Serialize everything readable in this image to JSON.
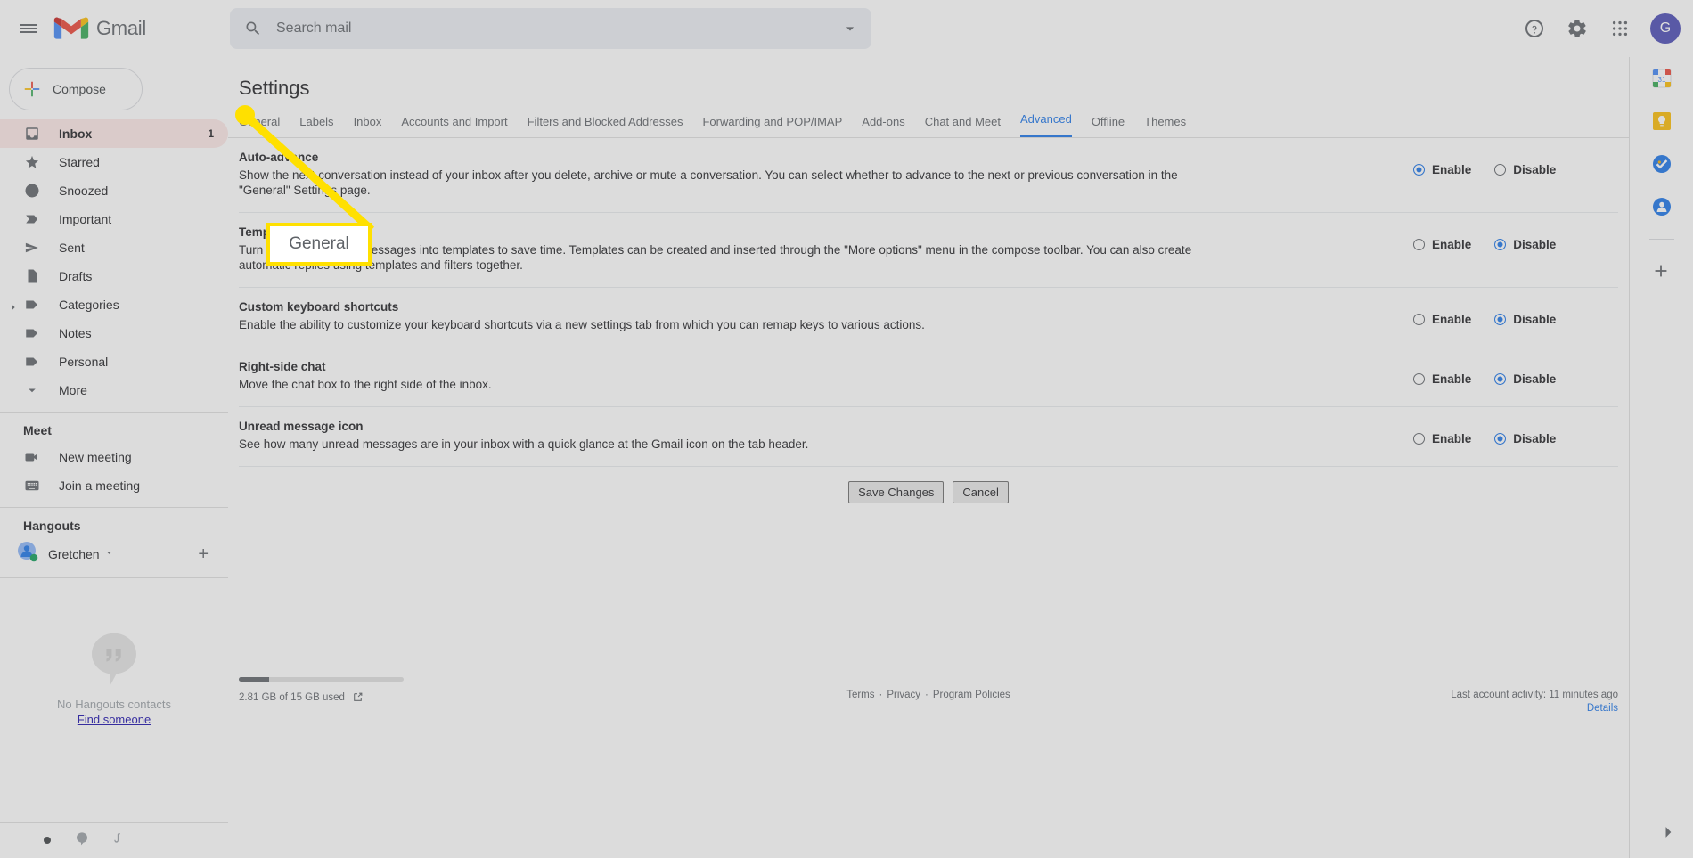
{
  "topbar": {
    "menu_icon": "hamburger-icon",
    "brand": "Gmail",
    "search": {
      "placeholder": "Search mail",
      "value": "",
      "icon": "search-icon",
      "options_icon": "chevron-down-icon"
    },
    "help_icon": "help-circle-icon",
    "settings_icon": "gear-icon",
    "apps_icon": "apps-grid-icon",
    "avatar_letter": "G"
  },
  "sidebar": {
    "compose_label": "Compose",
    "items": [
      {
        "label": "Inbox",
        "icon": "inbox-icon",
        "count": "1",
        "active": true
      },
      {
        "label": "Starred",
        "icon": "star-icon",
        "count": "",
        "active": false
      },
      {
        "label": "Snoozed",
        "icon": "clock-icon",
        "count": "",
        "active": false
      },
      {
        "label": "Important",
        "icon": "important-marker-icon",
        "count": "",
        "active": false
      },
      {
        "label": "Sent",
        "icon": "send-icon",
        "count": "",
        "active": false
      },
      {
        "label": "Drafts",
        "icon": "draft-file-icon",
        "count": "",
        "active": false
      },
      {
        "label": "Categories",
        "icon": "label-tag-icon",
        "count": "",
        "active": false,
        "expandable": true
      },
      {
        "label": "Notes",
        "icon": "label-tag-icon",
        "count": "",
        "active": false
      },
      {
        "label": "Personal",
        "icon": "label-tag-icon",
        "count": "",
        "active": false
      },
      {
        "label": "More",
        "icon": "chevron-down-icon",
        "count": "",
        "active": false
      }
    ],
    "meet": {
      "title": "Meet",
      "items": [
        {
          "label": "New meeting",
          "icon": "video-camera-icon"
        },
        {
          "label": "Join a meeting",
          "icon": "keyboard-icon"
        }
      ]
    },
    "hangouts": {
      "title": "Hangouts",
      "user": "Gretchen",
      "user_caret_icon": "caret-down-icon",
      "add_icon": "plus-icon",
      "empty_text": "No Hangouts contacts",
      "find_link": "Find someone",
      "bubble_icon": "hangouts-quote-icon"
    },
    "bottom_icons": [
      "status-dot-icon",
      "hangouts-icon",
      "phone-icon"
    ]
  },
  "main": {
    "page_title": "Settings",
    "tabs": [
      {
        "label": "General",
        "active": false
      },
      {
        "label": "Labels",
        "active": false
      },
      {
        "label": "Inbox",
        "active": false
      },
      {
        "label": "Accounts and Import",
        "active": false
      },
      {
        "label": "Filters and Blocked Addresses",
        "active": false
      },
      {
        "label": "Forwarding and POP/IMAP",
        "active": false
      },
      {
        "label": "Add-ons",
        "active": false
      },
      {
        "label": "Chat and Meet",
        "active": false
      },
      {
        "label": "Advanced",
        "active": true
      },
      {
        "label": "Offline",
        "active": false
      },
      {
        "label": "Themes",
        "active": false
      }
    ],
    "enable_label": "Enable",
    "disable_label": "Disable",
    "settings": [
      {
        "title": "Auto-advance",
        "description": "Show the next conversation instead of your inbox after you delete, archive or mute a conversation. You can select whether to advance to the next or previous conversation in the \"General\" Settings page.",
        "selected": "enable"
      },
      {
        "title": "Templates",
        "description": "Turn frequently written messages into templates to save time. Templates can be created and inserted through the \"More options\" menu in the compose toolbar. You can also create automatic replies using templates and filters together.",
        "selected": "disable"
      },
      {
        "title": "Custom keyboard shortcuts",
        "description": "Enable the ability to customize your keyboard shortcuts via a new settings tab from which you can remap keys to various actions.",
        "selected": "disable"
      },
      {
        "title": "Right-side chat",
        "description": "Move the chat box to the right side of the inbox.",
        "selected": "disable"
      },
      {
        "title": "Unread message icon",
        "description": "See how many unread messages are in your inbox with a quick glance at the Gmail icon on the tab header.",
        "selected": "disable"
      }
    ],
    "save_label": "Save Changes",
    "cancel_label": "Cancel"
  },
  "footer": {
    "storage_text": "2.81 GB of 15 GB used",
    "storage_percent": 18,
    "external_icon": "external-link-icon",
    "links": [
      "Terms",
      "Privacy",
      "Program Policies"
    ],
    "separator": "·",
    "last_activity": "Last account activity: 11 minutes ago",
    "details_label": "Details"
  },
  "right_rail": {
    "icons": [
      "google-calendar-icon",
      "google-keep-icon",
      "google-tasks-icon",
      "google-contacts-icon"
    ],
    "add_icon": "plus-icon",
    "expand_icon": "chevron-right-icon"
  },
  "annotation": {
    "label": "General",
    "marker_color": "#ffe000"
  }
}
